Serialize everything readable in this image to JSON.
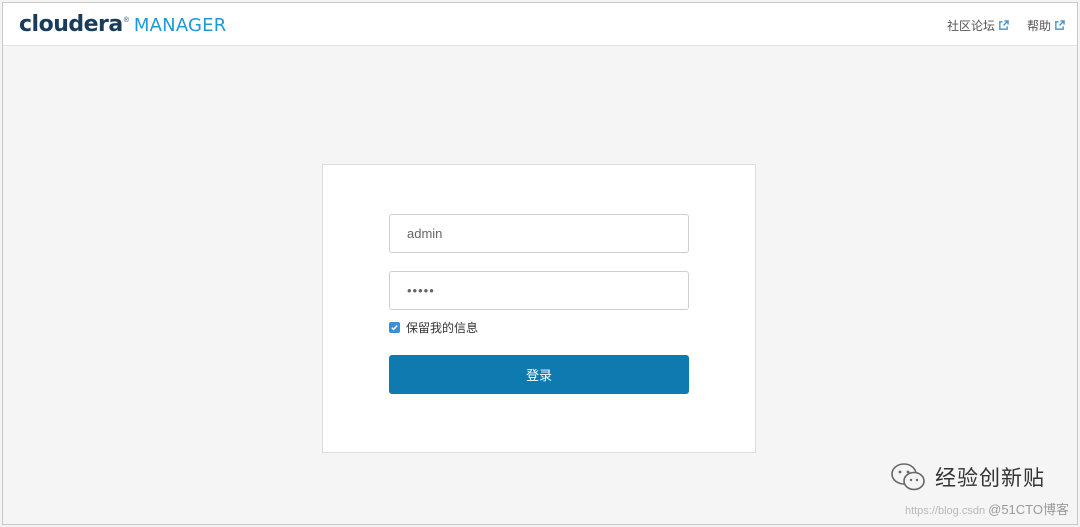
{
  "header": {
    "logo_word": "cloudera",
    "logo_reg": "®",
    "logo_product": "MANAGER",
    "nav": [
      {
        "label": "社区论坛",
        "icon": "external-link-icon"
      },
      {
        "label": "帮助",
        "icon": "external-link-icon"
      }
    ]
  },
  "login": {
    "username_value": "admin",
    "password_value": "•••••",
    "remember_label": "保留我的信息",
    "remember_checked": true,
    "submit_label": "登录"
  },
  "watermark": {
    "icon": "wechat-icon",
    "title": "经验创新贴",
    "url": "https://blog.csdn",
    "source": "@51CTO博客"
  },
  "colors": {
    "brand_dark": "#193b5c",
    "brand_light": "#1b9bd8",
    "button": "#0e7ab0",
    "checkbox": "#3b8ed8"
  }
}
